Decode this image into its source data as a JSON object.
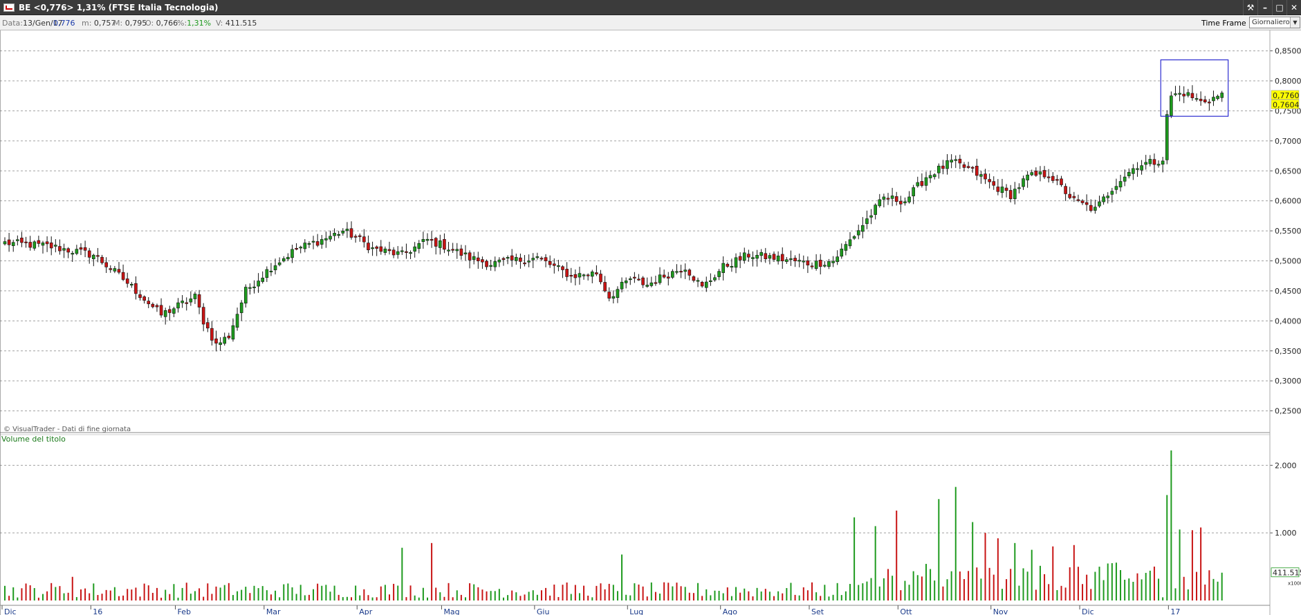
{
  "window": {
    "title": "BE <0,776> 1,31% (FTSE Italia Tecnologia)"
  },
  "info": {
    "data_label": "Data:",
    "data_value": "13/Gen/17",
    "close_value": "0,776",
    "m_label": "m:",
    "m_value": "0,757",
    "M_label": "M:",
    "M_value": "0,795",
    "O_label": "O:",
    "O_value": "0,766",
    "pct_label": "%:",
    "pct_value": "1,31%",
    "V_label": "V:",
    "V_value": "411.515"
  },
  "toolbar": {
    "timeframe_label": "Time Frame",
    "timeframe_value": "Giornaliero"
  },
  "colors": {
    "up": "#1e9a1e",
    "down": "#c81414",
    "wick": "#111111",
    "grid": "#a0a0a0",
    "highlight_box": "#2b2bd0",
    "label_bg": "#ffff00"
  },
  "chart_data": {
    "type": "candlestick",
    "title": "",
    "copyright": "© VisualTrader - Dati di fine giornata",
    "price_axis": {
      "ylim": [
        0.22,
        0.86
      ],
      "ticks": [
        0.85,
        0.8,
        0.75,
        0.7,
        0.65,
        0.6,
        0.55,
        0.5,
        0.45,
        0.4,
        0.35,
        0.3,
        0.25
      ],
      "tick_labels": [
        "0,8500",
        "0,8000",
        "0,7500",
        "0,7000",
        "0,6500",
        "0,6000",
        "0,5500",
        "0,5000",
        "0,4500",
        "0,4000",
        "0,3500",
        "0,3000",
        "0,2500"
      ],
      "grid": true
    },
    "price_labels": [
      {
        "text": "0,7760",
        "value": 0.776
      },
      {
        "text": "0,7604",
        "value": 0.7604
      }
    ],
    "months": [
      "Dic",
      "16",
      "Feb",
      "Mar",
      "Apr",
      "Mag",
      "Giu",
      "Lug",
      "Ago",
      "Set",
      "Ott",
      "Nov",
      "Dic",
      "17"
    ],
    "month_start_index": [
      0,
      21,
      41,
      62,
      84,
      104,
      126,
      148,
      170,
      191,
      212,
      234,
      255,
      276
    ],
    "red_months": [
      "16",
      "17"
    ],
    "close_anchors": [
      [
        0,
        0.53
      ],
      [
        10,
        0.525
      ],
      [
        21,
        0.51
      ],
      [
        28,
        0.47
      ],
      [
        34,
        0.43
      ],
      [
        37,
        0.41
      ],
      [
        45,
        0.44
      ],
      [
        47,
        0.4
      ],
      [
        50,
        0.36
      ],
      [
        53,
        0.375
      ],
      [
        57,
        0.45
      ],
      [
        63,
        0.49
      ],
      [
        69,
        0.52
      ],
      [
        75,
        0.535
      ],
      [
        80,
        0.55
      ],
      [
        83,
        0.54
      ],
      [
        87,
        0.52
      ],
      [
        94,
        0.51
      ],
      [
        100,
        0.535
      ],
      [
        104,
        0.525
      ],
      [
        110,
        0.505
      ],
      [
        115,
        0.495
      ],
      [
        120,
        0.5
      ],
      [
        126,
        0.505
      ],
      [
        134,
        0.475
      ],
      [
        140,
        0.48
      ],
      [
        143,
        0.44
      ],
      [
        148,
        0.47
      ],
      [
        152,
        0.46
      ],
      [
        156,
        0.475
      ],
      [
        161,
        0.49
      ],
      [
        165,
        0.455
      ],
      [
        170,
        0.49
      ],
      [
        176,
        0.51
      ],
      [
        182,
        0.505
      ],
      [
        191,
        0.495
      ],
      [
        196,
        0.5
      ],
      [
        203,
        0.56
      ],
      [
        208,
        0.605
      ],
      [
        213,
        0.6
      ],
      [
        218,
        0.64
      ],
      [
        224,
        0.665
      ],
      [
        229,
        0.65
      ],
      [
        234,
        0.625
      ],
      [
        238,
        0.61
      ],
      [
        242,
        0.64
      ],
      [
        247,
        0.645
      ],
      [
        253,
        0.6
      ],
      [
        258,
        0.585
      ],
      [
        263,
        0.63
      ],
      [
        268,
        0.66
      ],
      [
        272,
        0.665
      ],
      [
        274,
        0.67
      ],
      [
        275,
        0.74
      ],
      [
        276,
        0.775
      ],
      [
        279,
        0.78
      ],
      [
        283,
        0.765
      ],
      [
        288,
        0.776
      ]
    ],
    "volume": {
      "title": "Volume del titolo",
      "ylim": [
        0,
        2300
      ],
      "ticks": [
        1000,
        2000
      ],
      "tick_labels": [
        "1.000",
        "2.000"
      ],
      "unit": "x1000",
      "last_label": "411.515",
      "last_value": 411.5,
      "spikes": [
        [
          16,
          350
        ],
        [
          94,
          780
        ],
        [
          101,
          850
        ],
        [
          146,
          680
        ],
        [
          201,
          1230
        ],
        [
          206,
          1100
        ],
        [
          211,
          1330
        ],
        [
          221,
          1500
        ],
        [
          225,
          1680
        ],
        [
          229,
          1160
        ],
        [
          232,
          1000
        ],
        [
          235,
          920
        ],
        [
          239,
          850
        ],
        [
          243,
          750
        ],
        [
          248,
          800
        ],
        [
          253,
          820
        ],
        [
          259,
          500
        ],
        [
          263,
          560
        ],
        [
          275,
          1560
        ],
        [
          276,
          2220
        ],
        [
          278,
          1050
        ],
        [
          281,
          1040
        ],
        [
          283,
          1080
        ]
      ]
    },
    "highlight_box": {
      "start_index": 275,
      "end_index": 288,
      "low": 0.741,
      "high": 0.835
    }
  }
}
